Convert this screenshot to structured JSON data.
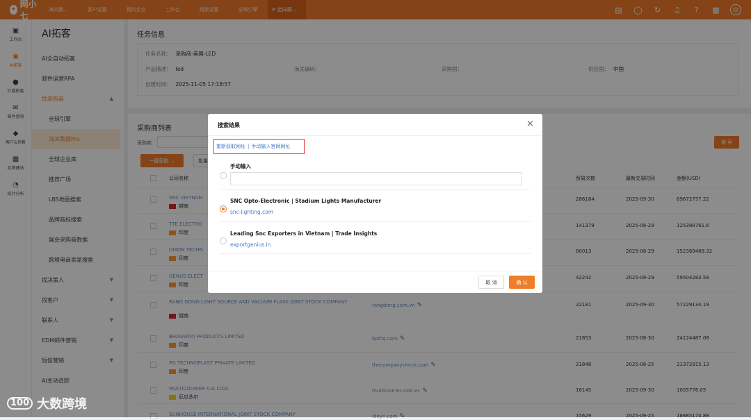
{
  "topbar": {
    "logo": "网小七",
    "tabs": [
      "海关数...",
      "客户设置",
      "我的企业",
      "工作台",
      "线索设置",
      "全球引擎",
      "定向获..."
    ],
    "icons": [
      "document-icon",
      "whatsapp-icon",
      "refresh-icon",
      "bell-icon",
      "help-icon",
      "grid-icon",
      "avatar-icon"
    ]
  },
  "leftnav": [
    {
      "label": "工作台",
      "icon": "monitor-icon",
      "glyph": "▣"
    },
    {
      "label": "AI拓客",
      "icon": "ai-icon",
      "glyph": "◉"
    },
    {
      "label": "社媒拓客",
      "icon": "user-icon",
      "glyph": "●"
    },
    {
      "label": "邮件营销",
      "icon": "mail-icon",
      "glyph": "✉"
    },
    {
      "label": "客户&销售",
      "icon": "customer-icon",
      "glyph": "◆"
    },
    {
      "label": "品牌建站",
      "icon": "site-icon",
      "glyph": "▦"
    },
    {
      "label": "统计分析",
      "icon": "chart-icon",
      "glyph": "◔"
    }
  ],
  "subnav": {
    "title": "AI拓客",
    "items": [
      {
        "label": "AI全自动拓客",
        "kind": "top"
      },
      {
        "label": "邮件运营RPA",
        "kind": "top"
      },
      {
        "label": "找采购商",
        "kind": "group-open"
      },
      {
        "label": "全球引擎",
        "kind": "sub"
      },
      {
        "label": "海关数据Pro",
        "kind": "sub-active"
      },
      {
        "label": "全球企业库",
        "kind": "sub"
      },
      {
        "label": "推荐广场",
        "kind": "sub"
      },
      {
        "label": "LBS地图搜索",
        "kind": "sub"
      },
      {
        "label": "品牌商标搜索",
        "kind": "sub"
      },
      {
        "label": "展会采购商数据",
        "kind": "sub"
      },
      {
        "label": "跨境电商卖家搜索",
        "kind": "sub"
      },
      {
        "label": "找决策人",
        "kind": "group"
      },
      {
        "label": "找客户",
        "kind": "group"
      },
      {
        "label": "联系人",
        "kind": "group"
      },
      {
        "label": "EDM邮件营销",
        "kind": "group"
      },
      {
        "label": "短信营销",
        "kind": "group"
      },
      {
        "label": "AI主动追踪",
        "kind": "top"
      }
    ]
  },
  "task": {
    "section_title": "任务信息",
    "name_label": "任务名称：",
    "name_value": "采购商-美国-LED",
    "product_label": "产品描述：",
    "product_value": "led",
    "hscode_label": "海关编码：",
    "buyer_country_label": "采购国：",
    "supplier_country_label": "供应国：",
    "supplier_country_value": "中国",
    "created_label": "创建时间：",
    "created_value": "2025-11-05 17:18:57"
  },
  "buyers": {
    "section_title": "采购商列表",
    "filter_label": "采购商",
    "search_button": "搜 索",
    "one_click_button": "一键营销",
    "batch_button": "批量",
    "columns": {
      "company": "公司名称",
      "trades": "贸易次数",
      "last_date": "最新交易时间",
      "amount": "金额(USD)"
    },
    "rows": [
      {
        "name": "SNC VIETNAM",
        "country": "越南",
        "flag": "vn",
        "website": "",
        "trades": "286164",
        "date": "2025-09-30",
        "amount": "69672757.22"
      },
      {
        "name": "TTE ELECTRO",
        "country": "印度",
        "flag": "in",
        "website": "",
        "trades": "141379",
        "date": "2025-08-29",
        "amount": "125388761.6"
      },
      {
        "name": "DIXON TECHN",
        "country": "印度",
        "flag": "in",
        "website": "",
        "trades": "80013",
        "date": "2025-08-29",
        "amount": "152369488.32"
      },
      {
        "name": "GENUS ELECT",
        "country": "印度",
        "flag": "in",
        "website": "",
        "trades": "42242",
        "date": "2025-08-29",
        "amount": "59504283.58"
      },
      {
        "name": "RANG DONG LIGHT SOURCE AND VACUUM FLASK JOINT STOCK COMPANY",
        "country": "越南",
        "flag": "vn",
        "website": "rangdong.com.vn",
        "trades": "22181",
        "date": "2025-09-30",
        "amount": "57229134.19"
      },
      {
        "name": "BHAGWATI PRODUCTS LIMITED",
        "country": "印度",
        "flag": "in",
        "website": "bplhq.com",
        "trades": "21853",
        "date": "2025-08-30",
        "amount": "24124487.08"
      },
      {
        "name": "PG TECHNOPLAST PRIVATE LIMITED",
        "country": "印度",
        "flag": "in",
        "website": "thecompanycheck.com",
        "trades": "21848",
        "date": "2025-08-25",
        "amount": "21372915.13"
      },
      {
        "name": "MULTICOURIER CIA LTDA",
        "country": "厄瓜多尔",
        "flag": "ec",
        "website": "multicourier.com.ec",
        "trades": "16145",
        "date": "2025-09-30",
        "amount": "1005776.05"
      },
      {
        "name": "SUNHOUSE INTERNATIONAL JOINT STOCK COMPANY",
        "country": "",
        "flag": "",
        "website": "idoyn.com",
        "trades": "15629",
        "date": "2025-09-25",
        "amount": "18885174.88"
      }
    ]
  },
  "modal": {
    "title": "搜索结果",
    "link_refetch": "重新获取网址",
    "link_separator": "|",
    "link_manual": "手动输入官网网址",
    "manual_label": "手动输入",
    "manual_value": "",
    "options": [
      {
        "title": "SNC Opto-Electronic | Stadium Lights Manufacturer",
        "url": "snc-lighting.com",
        "selected": true
      },
      {
        "title": "Leading Snc Exporters in Vietnam | Trade Insights",
        "url": "exportgenius.in",
        "selected": false
      }
    ],
    "cancel": "取 消",
    "confirm": "确 认"
  },
  "watermark": {
    "mark": "100",
    "text": "大数跨境"
  },
  "colors": {
    "accent": "#f07d2a",
    "link": "#4a7bc5",
    "highlight_border": "#e33333"
  }
}
